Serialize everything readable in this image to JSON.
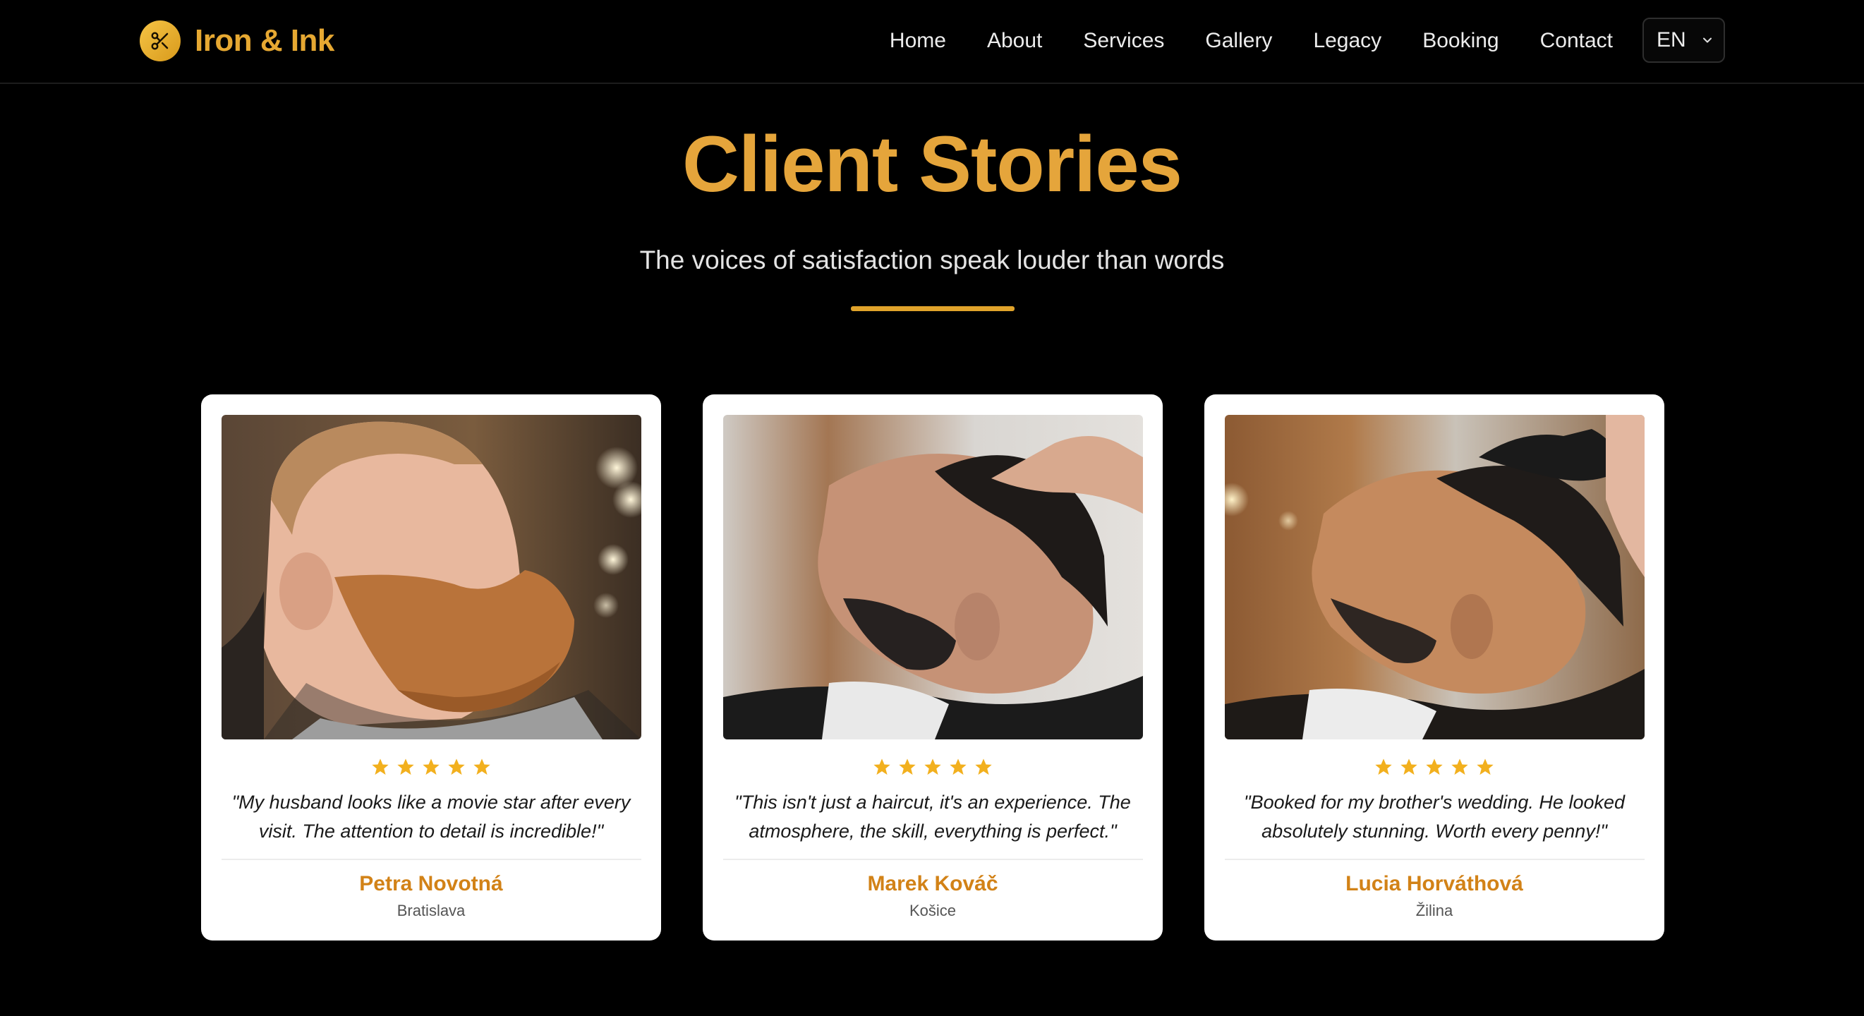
{
  "nav": {
    "brand": "Iron & Ink",
    "brand_icon": "scissors-icon",
    "links": [
      "Home",
      "About",
      "Services",
      "Gallery",
      "Legacy",
      "Booking",
      "Contact"
    ],
    "language": "EN"
  },
  "hero": {
    "title": "Client Stories",
    "subtitle": "The voices of satisfaction speak louder than words"
  },
  "testimonials": [
    {
      "rating": 5,
      "quote": "\"My husband looks like a movie star after every visit. The attention to detail is incredible!\"",
      "name": "Petra Novotná",
      "city": "Bratislava"
    },
    {
      "rating": 5,
      "quote": "\"This isn't just a haircut, it's an experience. The atmosphere, the skill, everything is perfect.\"",
      "name": "Marek Kováč",
      "city": "Košice"
    },
    {
      "rating": 5,
      "quote": "\"Booked for my brother's wedding. He looked absolutely stunning. Worth every penny!\"",
      "name": "Lucia Horváthová",
      "city": "Žilina"
    }
  ],
  "colors": {
    "accent": "#e5a53b",
    "name": "#d28217",
    "star": "#f2b01e",
    "background": "#000000",
    "card": "#ffffff"
  }
}
